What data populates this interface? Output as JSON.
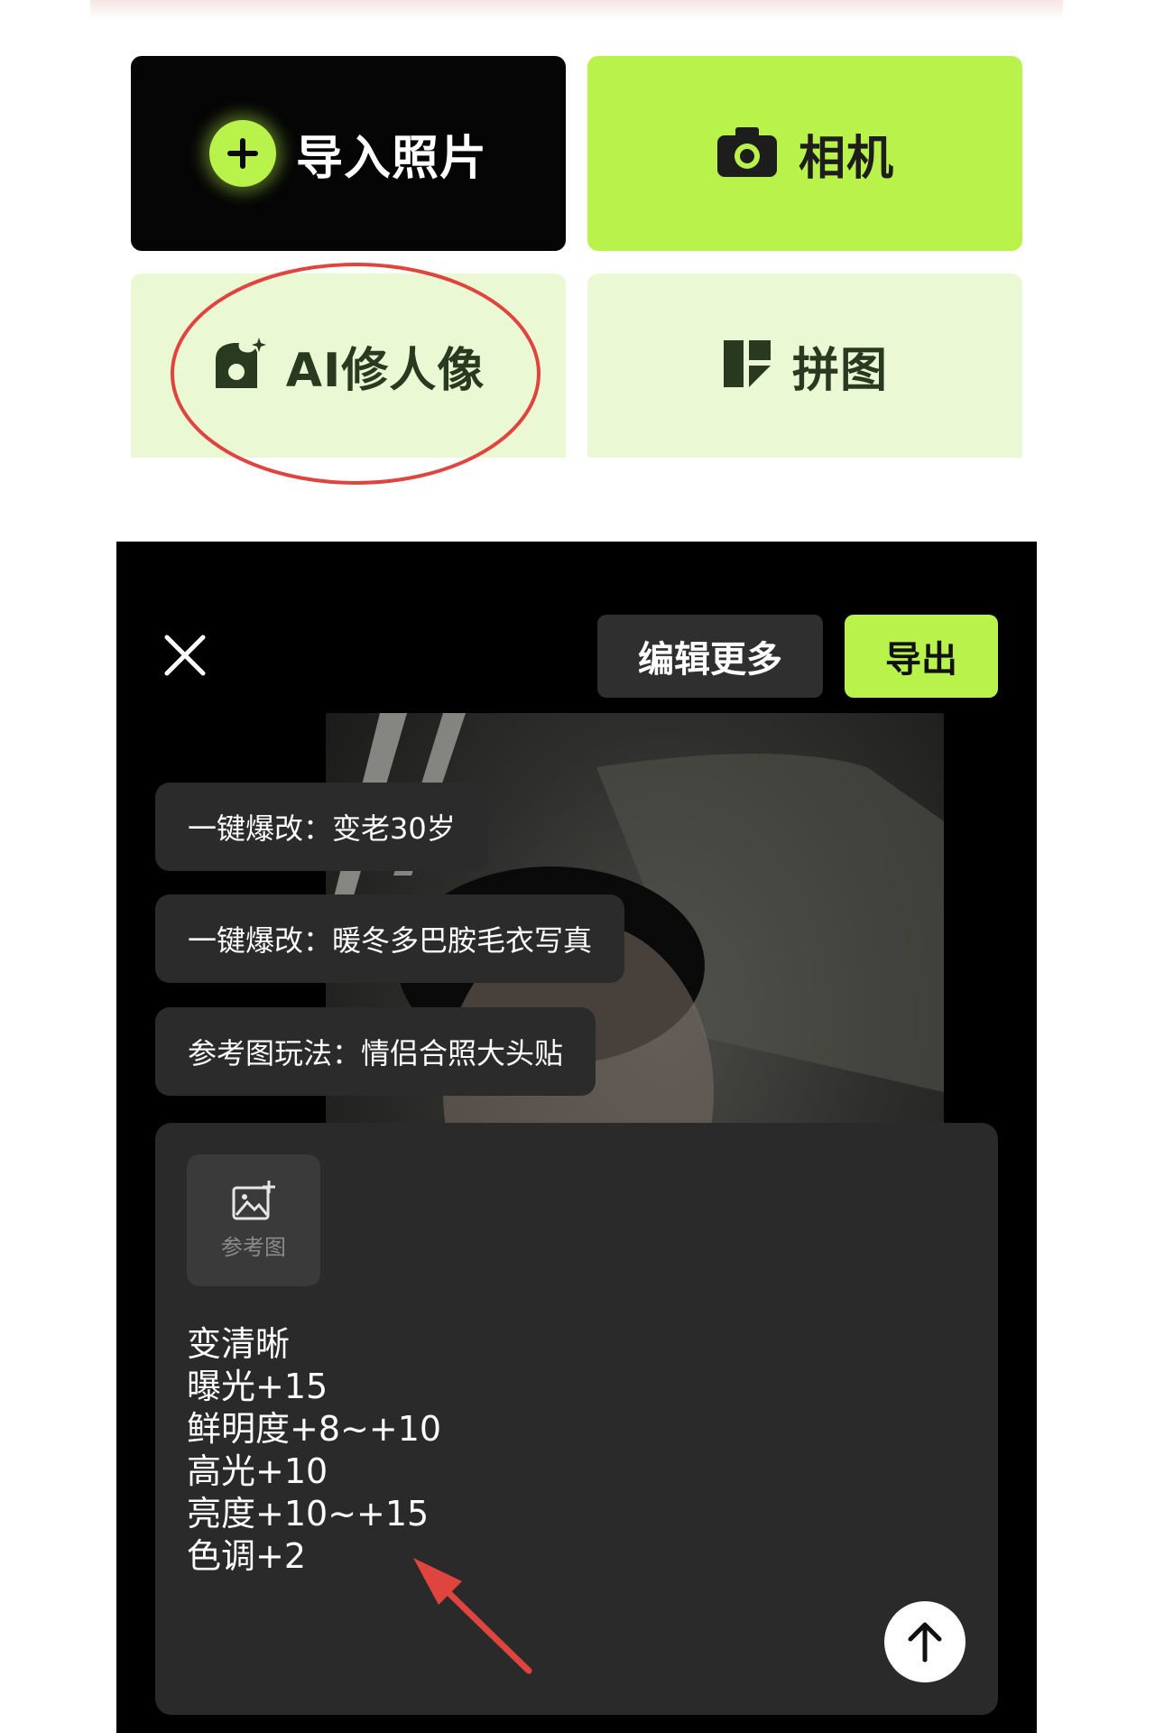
{
  "tiles": {
    "import_label": "导入照片",
    "camera_label": "相机",
    "ai_label": "AI修人像",
    "collage_label": "拼图"
  },
  "editor": {
    "edit_more_label": "编辑更多",
    "export_label": "导出",
    "suggestions": [
      "一键爆改：变老30岁",
      "一键爆改：暖冬多巴胺毛衣写真",
      "参考图玩法：情侣合照大头贴"
    ],
    "reference_label": "参考图",
    "prompt_lines": [
      "变清晰",
      "曝光+15",
      "鲜明度+8~+10",
      "高光+10",
      "亮度+10~+15",
      "色调+2"
    ]
  },
  "colors": {
    "accent": "#b9f24a",
    "tile_light": "#eaf9d4",
    "annotation": "#e0443e"
  },
  "icons": [
    "plus-icon",
    "camera-icon",
    "ai-portrait-icon",
    "collage-icon",
    "close-icon",
    "image-add-icon",
    "arrow-up-icon"
  ]
}
